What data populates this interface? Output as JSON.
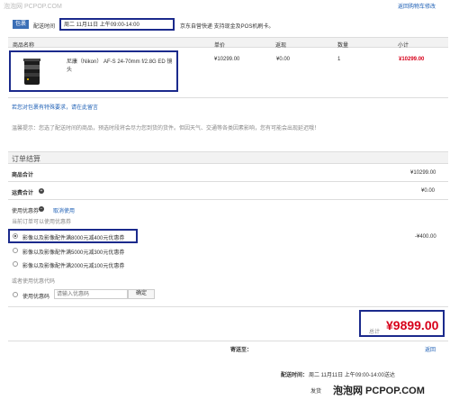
{
  "watermark_top": "泡泡网 PCPOP.COM",
  "delivery": {
    "badge": "包裹",
    "label": "配送时间",
    "selected": "周二 11月11日 上午09:00-14:00",
    "note": "京东自营快递 支持现金及POS机刷卡。",
    "back_link": "返回购物车修改"
  },
  "table": {
    "headers": [
      "商品名称",
      "单价",
      "返现",
      "数量",
      "小计"
    ],
    "row": {
      "name": "尼康（Nikon） AF-S 24-70mm f/2.8G ED 镜头",
      "price": "¥10299.00",
      "cashback": "¥0.00",
      "qty": "1",
      "subtotal": "¥10299.00"
    }
  },
  "special_request_link": "若您对包裹有特殊要求，请在此留言",
  "tip": "温馨提示：您选了配送时间的商品，预选时段将会尽力您到货的货件。但因天气、交通等各类因素影响，您有可能会出现延迟哦！",
  "settlement": {
    "title": "订单结算",
    "goods_total_label": "商品合计",
    "goods_total_value": "¥10299.00",
    "shipping_label": "运费合计",
    "shipping_value": "¥0.00",
    "coupon_label": "使用优惠券",
    "coupon_cancel": "取消使用",
    "coupon_hint": "当前订单可以使用优惠券",
    "coupons": [
      {
        "label": "影像以及影像配件满8000元减400元优惠券",
        "amount": "-¥400.00",
        "checked": true
      },
      {
        "label": "影像以及影像配件满5000元减300元优惠券",
        "amount": "",
        "checked": false
      },
      {
        "label": "影像以及影像配件满2000元减100元优惠券",
        "amount": "",
        "checked": false
      }
    ],
    "code_hint": "或者使用优惠代码",
    "code_label": "使用优惠码",
    "code_placeholder": "请输入优惠码",
    "code_button": "确定",
    "total_label": "总计",
    "total_value": "¥9899.00"
  },
  "footer": {
    "recipient_label": "寄送至：",
    "edit_link": "返回",
    "delivery_label": "配送时间：",
    "delivery_value": "周二 11月11日 上午09:00-14:00送达",
    "ship_label": "发货",
    "watermark_bottom": "泡泡网 PCPOP.COM"
  },
  "colors": {
    "accent": "#1d5fb5",
    "price_red": "#d7001a",
    "highlight_box": "#1b2a8c"
  }
}
